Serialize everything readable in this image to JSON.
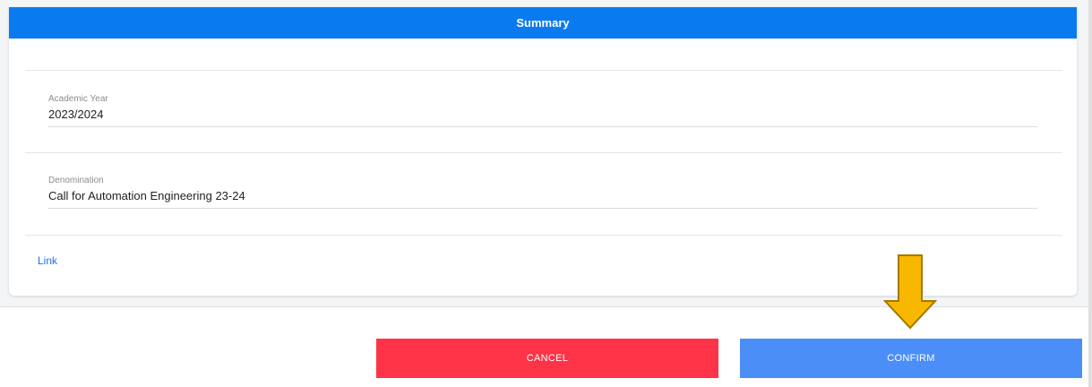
{
  "summary": {
    "title": "Summary",
    "fields": [
      {
        "label": "Academic Year",
        "value": "2023/2024"
      },
      {
        "label": "Denomination",
        "value": "Call for Automation Engineering 23-24"
      }
    ],
    "link_label": "Link"
  },
  "actions": {
    "cancel_label": "CANCEL",
    "confirm_label": "CONFIRM"
  },
  "colors": {
    "header": "#0a7af0",
    "cancel": "#ff3347",
    "confirm": "#4c8ef7",
    "arrow": "#f9b800"
  },
  "annotation": {
    "icon": "arrow-down-icon"
  }
}
